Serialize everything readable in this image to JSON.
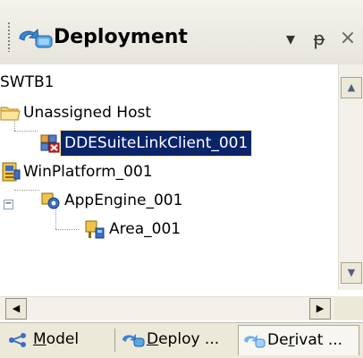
{
  "panel": {
    "title": "Deployment",
    "title_icon": "deployment-icon",
    "buttons": {
      "menu": "▾",
      "pin": "ᵽ",
      "close": "×"
    }
  },
  "tree": {
    "root": "SWTB1",
    "nodes": [
      {
        "label": "Unassigned Host",
        "icon": "folder-icon"
      },
      {
        "label": "DDESuiteLinkClient_001",
        "icon": "ddesuitelink-error-icon",
        "selected": true
      },
      {
        "label": "WinPlatform_001",
        "icon": "platform-icon"
      },
      {
        "label": "AppEngine_001",
        "icon": "appengine-icon",
        "expanded": true
      },
      {
        "label": "Area_001",
        "icon": "area-icon"
      }
    ]
  },
  "scrollbars": {
    "up": "▲",
    "down": "▼",
    "left": "◀",
    "right": "▶"
  },
  "tabs": [
    {
      "label": "Model",
      "mnemonic": "M",
      "icon": "model-icon"
    },
    {
      "label": "Deploy ...",
      "mnemonic": "D",
      "icon": "deploy-icon"
    },
    {
      "label": "Derivat ...",
      "mnemonic": "r",
      "icon": "derivation-icon",
      "active": true
    }
  ],
  "colors": {
    "selection": "#0a246a",
    "titlebar": "#eceae1",
    "chrome": "#ece9d8"
  }
}
